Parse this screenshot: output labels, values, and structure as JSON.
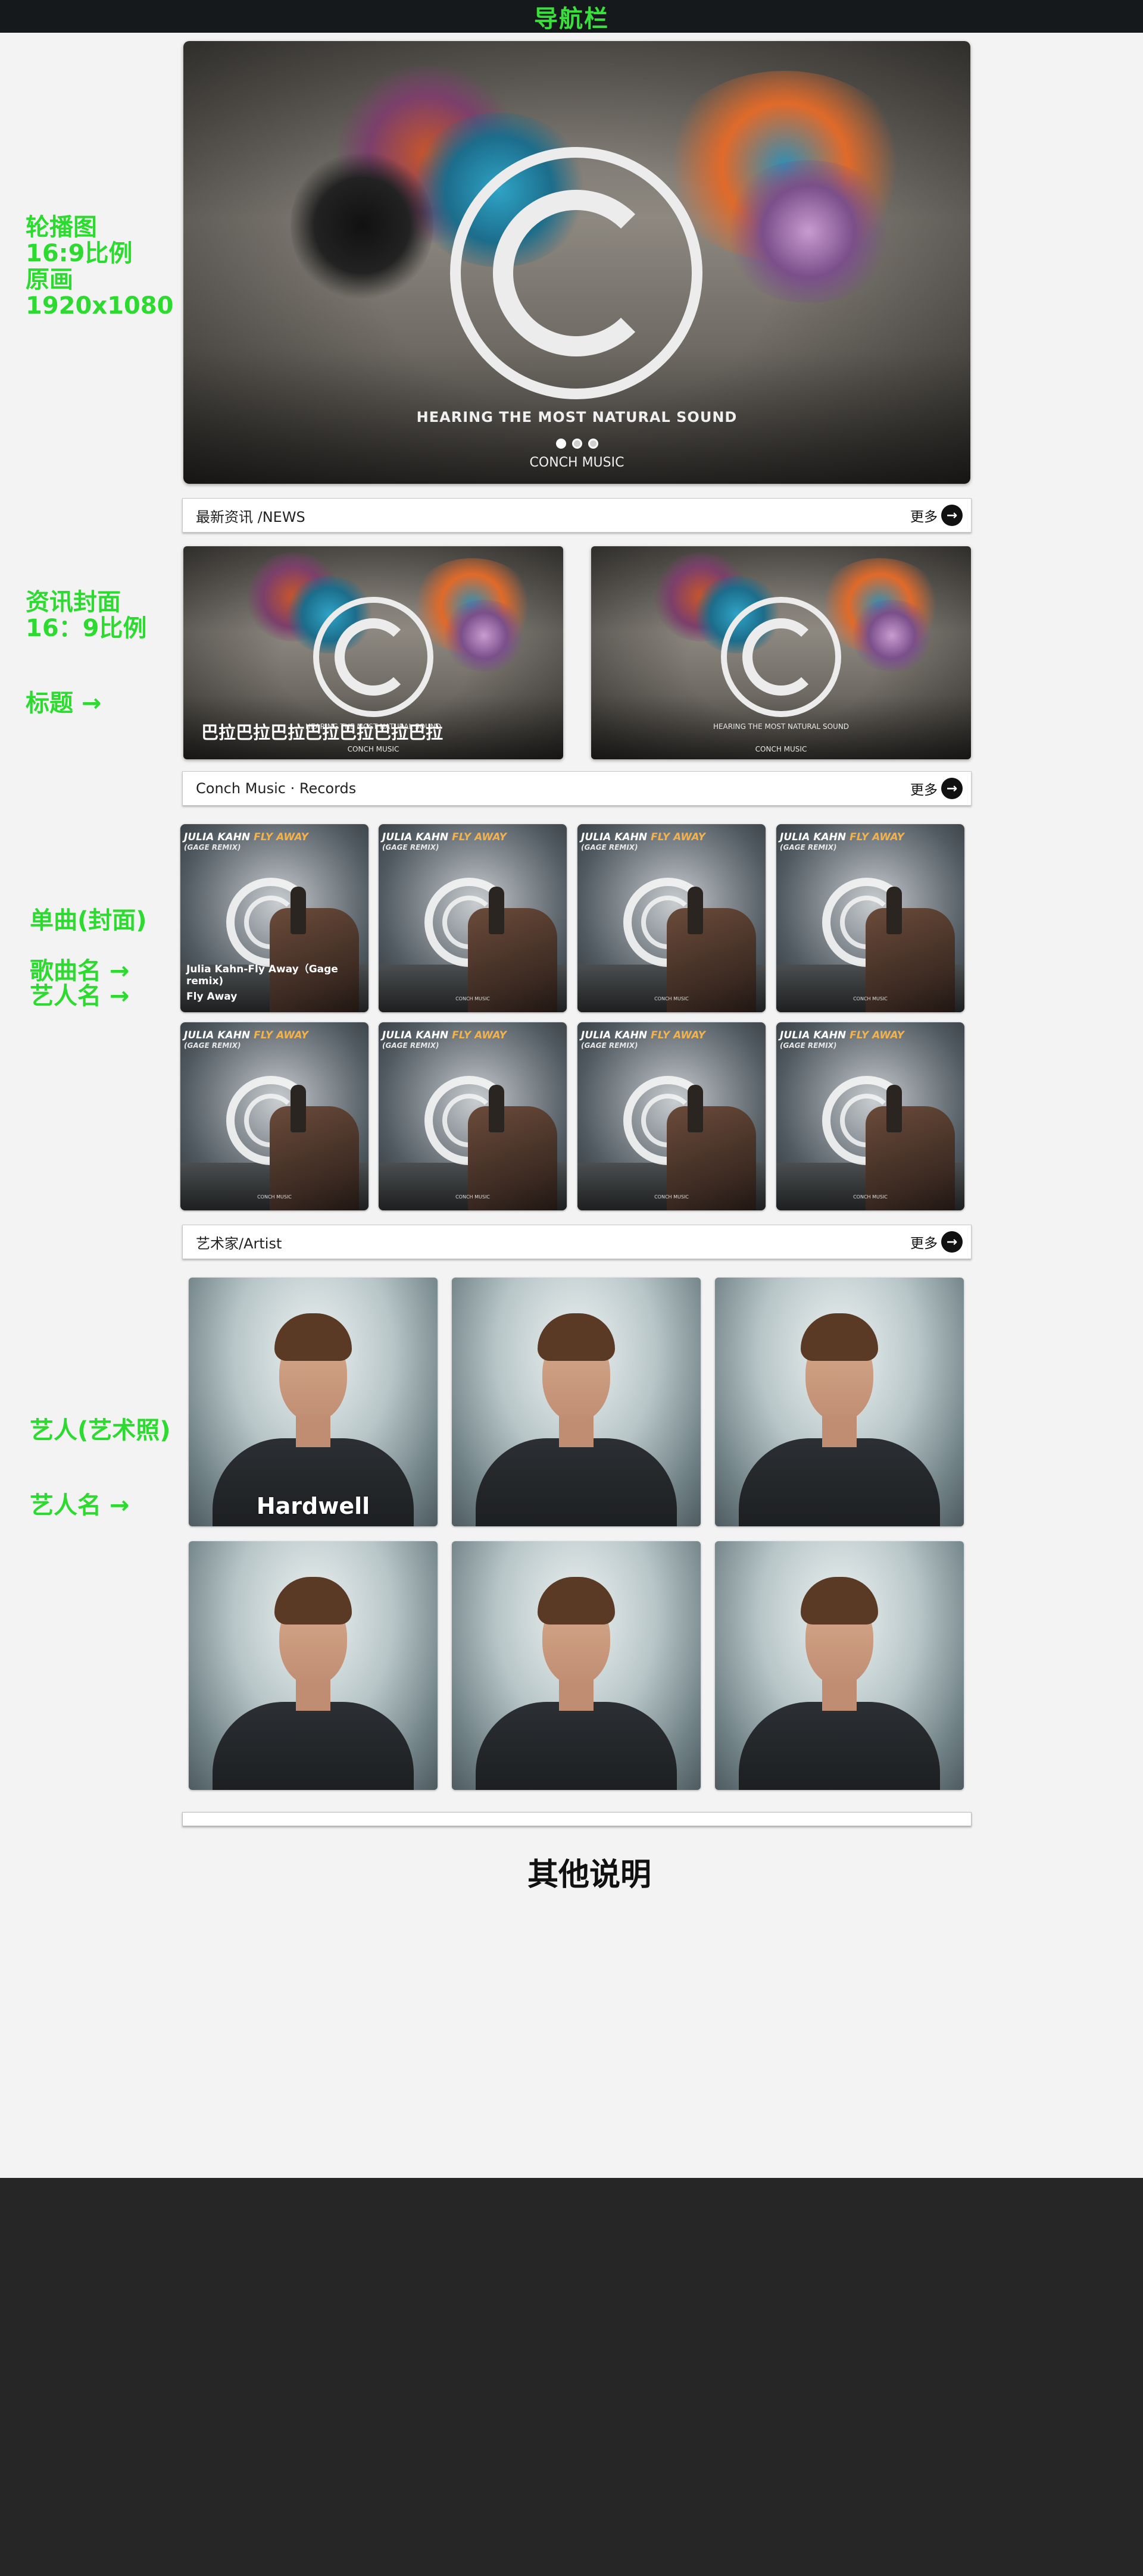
{
  "navbar": {
    "title": "导航栏"
  },
  "annotations": {
    "carousel": [
      "轮播图",
      "16:9比例",
      "原画",
      "1920x1080"
    ],
    "news_cover": [
      "资讯封面",
      "16：9比例"
    ],
    "news_title": "标题 →",
    "single": "单曲(封面)",
    "song_name": "歌曲名 →",
    "artist_name_single": "艺人名 →",
    "artist_photo": "艺人(艺术照)",
    "artist_name": "艺人名 →"
  },
  "carousel": {
    "tagline": "HEARING THE MOST NATURAL SOUND",
    "brand": "CONCH MUSIC",
    "slide_count": 3,
    "active_slide": 1
  },
  "news": {
    "section_title": "最新资讯 /NEWS",
    "more_label": "更多",
    "items": [
      {
        "caption": "巴拉巴拉巴拉巴拉巴拉巴拉巴拉",
        "tag": "HEARING THE MOST NATURAL SOUND",
        "brand": "CONCH MUSIC"
      },
      {
        "caption": "",
        "tag": "HEARING THE MOST NATURAL SOUND",
        "brand": "CONCH MUSIC"
      }
    ]
  },
  "records": {
    "section_title": "Conch Music · Records",
    "more_label": "更多",
    "cover_text": {
      "artist": "JULIA KAHN",
      "title": "FLY AWAY",
      "remix": "(GAGE REMIX)",
      "label": "CONCH MUSIC"
    },
    "featured": {
      "song": "Julia Kahn-Fly Away（Gage remix)",
      "artist": "Fly Away"
    }
  },
  "artists": {
    "section_title": "艺术家/Artist",
    "more_label": "更多",
    "featured_name": "Hardwell"
  },
  "other": {
    "title": "其他说明"
  },
  "colors": {
    "accent": "#39e03c",
    "nav_bg": "#16191c",
    "footer_bg": "#262626",
    "cover_highlight": "#f4b24c"
  }
}
